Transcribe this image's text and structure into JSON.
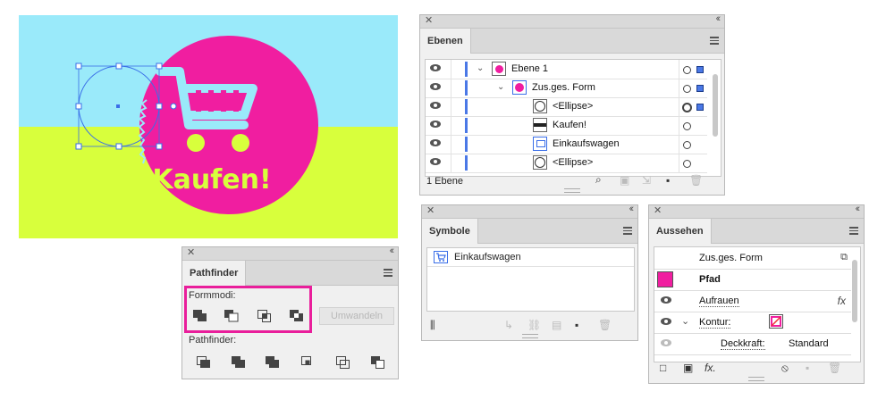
{
  "artwork": {
    "headline": "Kaufen!",
    "colors": {
      "sky": "#9aeafa",
      "ground": "#d8ff3c",
      "circle": "#f01ea0",
      "cart": "#9aeafa",
      "text": "#d8ff3c",
      "selection": "#3a6ee8"
    }
  },
  "ebenen": {
    "tab_label": "Ebenen",
    "layers": [
      {
        "name": "Ebene 1",
        "thumb": "layer-thumbnail"
      },
      {
        "name": "Zus.ges. Form",
        "thumb": "compound-shape-thumbnail"
      },
      {
        "name": "<Ellipse>",
        "thumb": "ellipse-thumbnail"
      },
      {
        "name": "Kaufen!",
        "thumb": "text-thumbnail"
      },
      {
        "name": "Einkaufswagen",
        "thumb": "symbol-thumbnail"
      },
      {
        "name": "<Ellipse>",
        "thumb": "ellipse-thumbnail"
      }
    ],
    "footer_count": "1 Ebene"
  },
  "symbole": {
    "tab_label": "Symbole",
    "items": [
      {
        "name": "Einkaufswagen",
        "icon": "shopping-cart-icon"
      }
    ]
  },
  "pathfinder": {
    "tab_label": "Pathfinder",
    "formmodi_label": "Formmodi:",
    "pathfinder_label": "Pathfinder:",
    "umwandeln_label": "Umwandeln"
  },
  "aussehen": {
    "tab_label": "Aussehen",
    "object_label": "Zus.ges. Form",
    "path_label": "Pfad",
    "effect_label": "Aufrauen",
    "fx_label": "fx",
    "stroke_label": "Kontur:",
    "opacity_label": "Deckkraft:",
    "opacity_value": "Standard",
    "footer_fx": "fx."
  }
}
